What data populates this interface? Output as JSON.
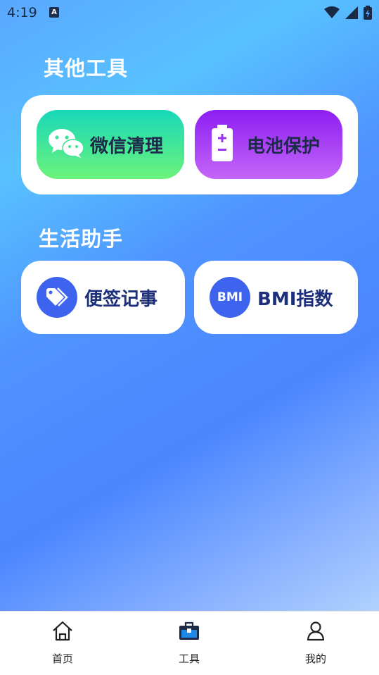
{
  "status_bar": {
    "time": "4:19",
    "notification_icon": "A"
  },
  "other_tools": {
    "title": "其他工具",
    "items": [
      {
        "label": "微信清理",
        "icon": "wechat-icon"
      },
      {
        "label": "电池保护",
        "icon": "battery-icon"
      }
    ]
  },
  "life_assistant": {
    "title": "生活助手",
    "items": [
      {
        "label": "便签记事",
        "icon": "tag-icon"
      },
      {
        "label": "BMI指数",
        "icon_text": "BMI"
      }
    ]
  },
  "bottom_nav": {
    "items": [
      {
        "label": "首页",
        "icon": "home-icon"
      },
      {
        "label": "工具",
        "icon": "toolbox-icon",
        "active": true
      },
      {
        "label": "我的",
        "icon": "user-icon"
      }
    ]
  },
  "colors": {
    "accent_blue": "#3d63ef",
    "label_dark": "#1d2f7a",
    "wechat_gradient": [
      "#17d8b9",
      "#6cf37a"
    ],
    "battery_gradient": [
      "#8d1ef2",
      "#c466f7"
    ]
  }
}
